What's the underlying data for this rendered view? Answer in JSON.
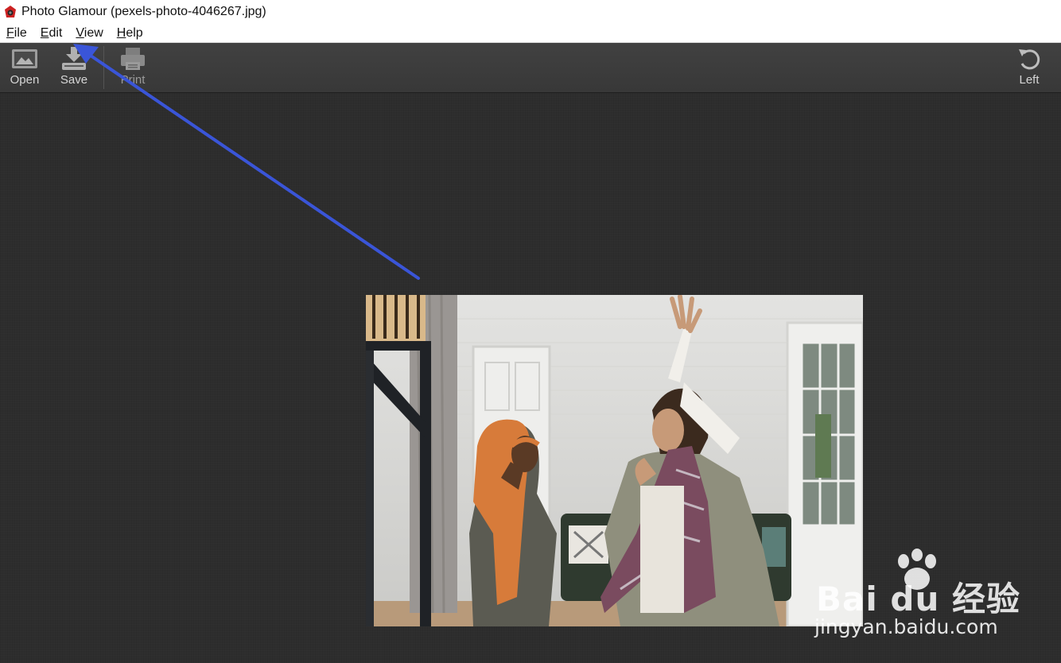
{
  "window": {
    "title": "Photo Glamour (pexels-photo-4046267.jpg)"
  },
  "menu": {
    "items": [
      {
        "label": "File",
        "mnemonic": "F",
        "rest": "ile"
      },
      {
        "label": "Edit",
        "mnemonic": "E",
        "rest": "dit"
      },
      {
        "label": "View",
        "mnemonic": "V",
        "rest": "iew"
      },
      {
        "label": "Help",
        "mnemonic": "H",
        "rest": "elp"
      }
    ]
  },
  "toolbar": {
    "open_label": "Open",
    "save_label": "Save",
    "print_label": "Print",
    "rotate_left_label": "Left"
  },
  "watermark": {
    "brand_text": "Bai du 经验",
    "url": "jingyan.baidu.com"
  },
  "colors": {
    "annotation_arrow": "#3a55d8",
    "toolbar_bg": "#3d3d3d",
    "canvas_bg": "#2d2d2d"
  },
  "icons": {
    "app": "camera-app-icon",
    "open": "image-open-icon",
    "save": "download-save-icon",
    "print": "printer-icon",
    "rotate_left": "rotate-left-icon"
  }
}
